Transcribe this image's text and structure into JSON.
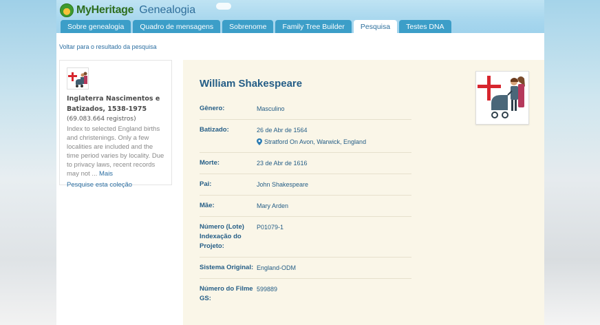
{
  "brand": {
    "name": "MyHeritage",
    "section": "Genealogia"
  },
  "tabs": [
    {
      "label": "Sobre genealogia",
      "active": false
    },
    {
      "label": "Quadro de mensagens",
      "active": false
    },
    {
      "label": "Sobrenome",
      "active": false
    },
    {
      "label": "Family Tree Builder",
      "active": false
    },
    {
      "label": "Pesquisa",
      "active": true
    },
    {
      "label": "Testes DNA",
      "active": false
    }
  ],
  "back_link": "Voltar para o resultado da pesquisa",
  "collection": {
    "title": "Inglaterra Nascimentos e Batizados, 1538-1975",
    "count": "(69.083.664 registros)",
    "description": "Index to selected England births and christenings. Only a few localities are included and the time period varies by locality. Due to privacy laws, recent records may not ...",
    "more": "Mais",
    "search_link": "Pesquise esta coleção"
  },
  "record": {
    "name": "William Shakespeare",
    "fields": [
      {
        "label": "Gênero:",
        "value": "Masculino"
      },
      {
        "label": "Batizado:",
        "value": "26 de Abr de 1564",
        "place": "Stratford On Avon, Warwick, England"
      },
      {
        "label": "Morte:",
        "value": "23 de Abr de 1616"
      },
      {
        "label": "Pai:",
        "value": "John Shakespeare"
      },
      {
        "label": "Mãe:",
        "value": "Mary Arden"
      },
      {
        "label": "Número (Lote) Indexação do Projeto:",
        "value": "P01079-1"
      },
      {
        "label": "Sistema Original:",
        "value": "England-ODM"
      },
      {
        "label": "Número do Filme GS:",
        "value": "599889"
      }
    ]
  },
  "colors": {
    "tab_bg": "#3c9ec8",
    "link": "#2b6ea1",
    "label": "#245d86",
    "record_bg": "#faf6e8"
  },
  "icons": [
    "map-pin-icon",
    "england-flag-icon",
    "family-stroller-icon",
    "myheritage-logo-icon"
  ]
}
